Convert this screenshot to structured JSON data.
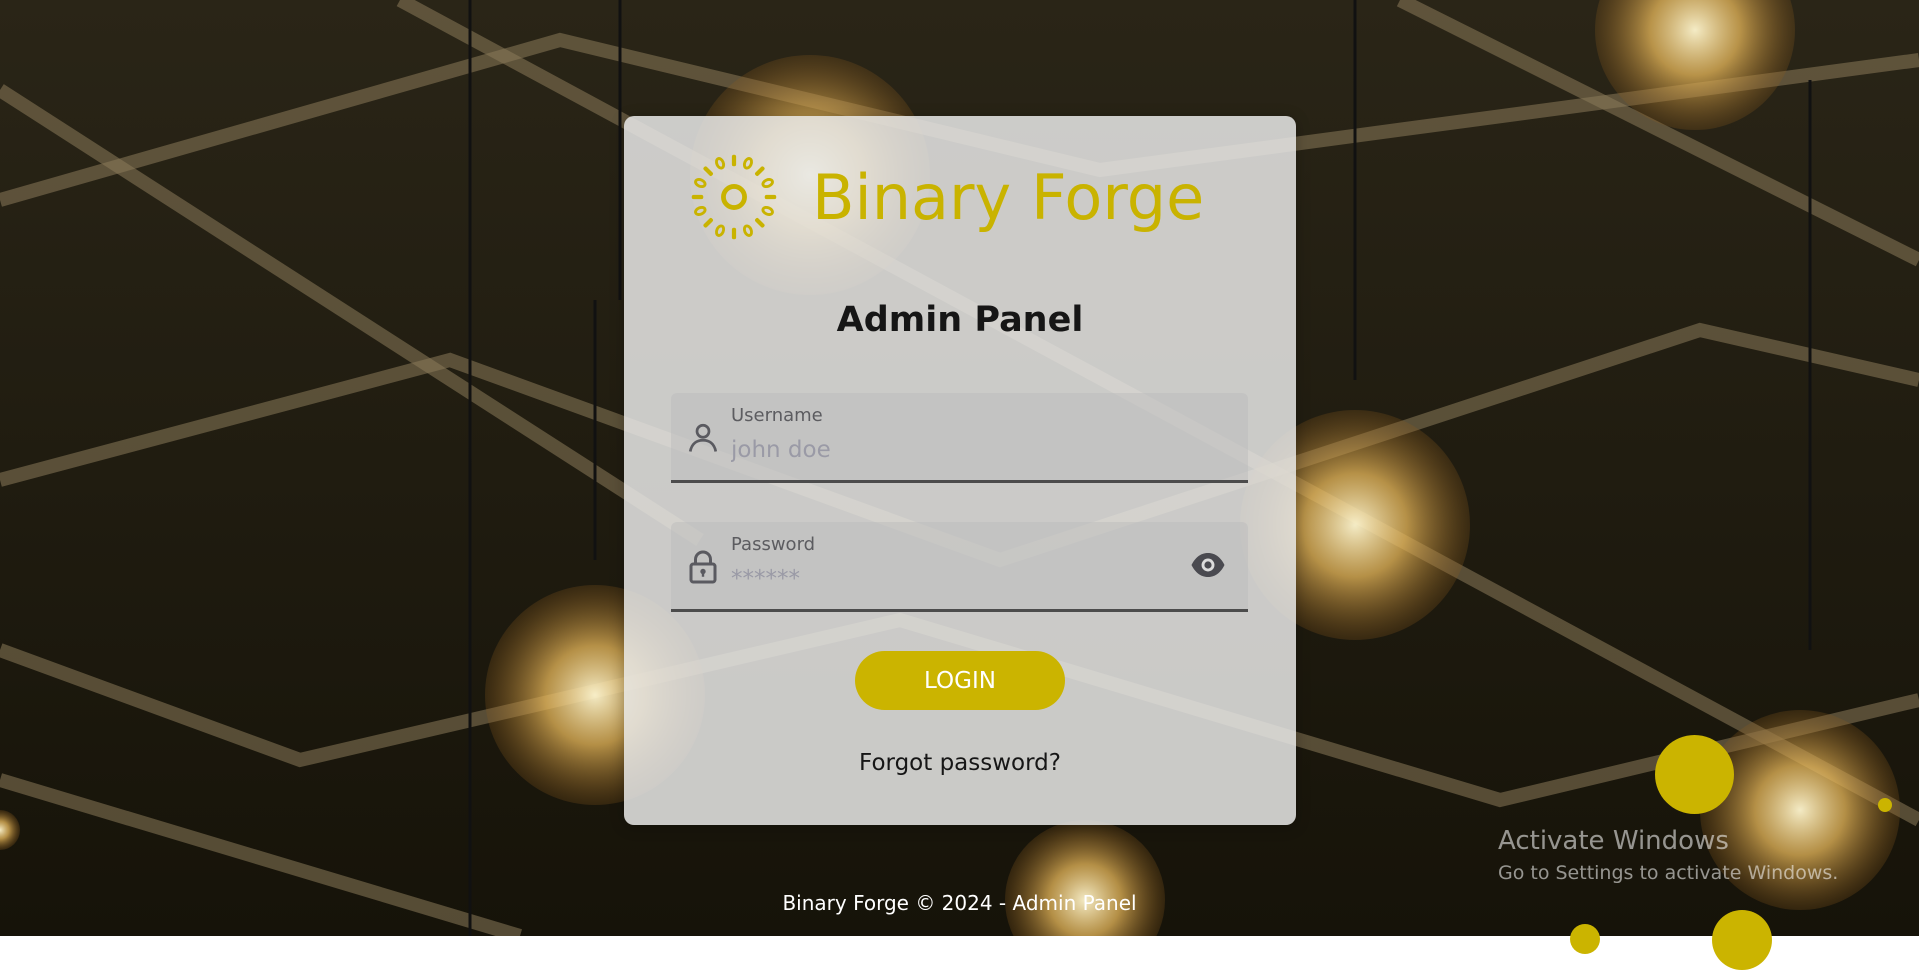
{
  "brand": {
    "name": "Binary Forge",
    "logo_icon": "binary-ring-logo",
    "accent_color": "#cbb400"
  },
  "panel": {
    "title": "Admin Panel"
  },
  "username": {
    "label": "Username",
    "placeholder": "john doe",
    "icon": "user-icon"
  },
  "password": {
    "label": "Password",
    "placeholder": "******",
    "icon": "lock-icon",
    "toggle_icon": "eye-icon"
  },
  "login_label": "LOGIN",
  "forgot_label": "Forgot password?",
  "footer_text": "Binary Forge © 2024 - Admin Panel",
  "watermark": {
    "title": "Activate Windows",
    "subtitle": "Go to Settings to activate Windows."
  }
}
